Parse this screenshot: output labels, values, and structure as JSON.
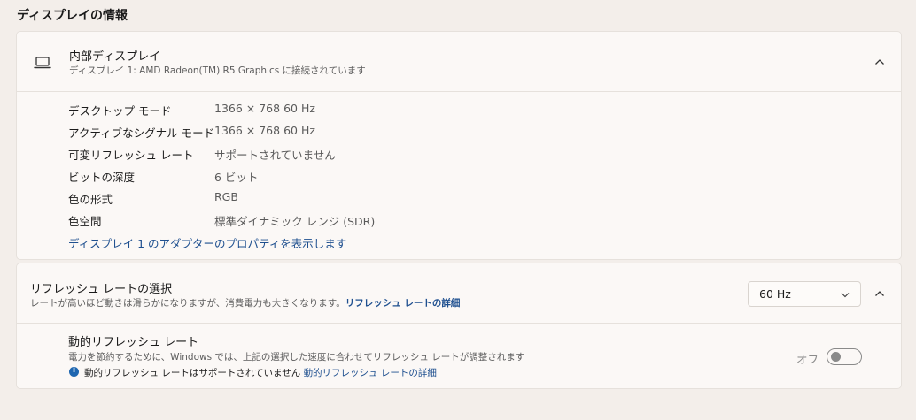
{
  "section_title": "ディスプレイの情報",
  "internal_display": {
    "title": "内部ディスプレイ",
    "subtitle": "ディスプレイ 1: AMD Radeon(TM) R5 Graphics に接続されています",
    "rows": [
      {
        "label": "デスクトップ モード",
        "value": "1366 × 768 60 Hz"
      },
      {
        "label": "アクティブなシグナル モード",
        "value": "1366 × 768 60 Hz"
      },
      {
        "label": "可変リフレッシュ レート",
        "value": "サポートされていません"
      },
      {
        "label": "ビットの深度",
        "value": "6 ビット"
      },
      {
        "label": "色の形式",
        "value": "RGB"
      },
      {
        "label": "色空間",
        "value": "標準ダイナミック レンジ (SDR)"
      }
    ],
    "adapter_link": "ディスプレイ 1 のアダプターのプロパティを表示します",
    "icon": "laptop-icon"
  },
  "refresh_rate": {
    "title": "リフレッシュ レートの選択",
    "description": "レートが高いほど動きは滑らかになりますが、消費電力も大きくなります。",
    "details_link": "リフレッシュ レートの詳細",
    "selected": "60 Hz",
    "dynamic": {
      "title": "動的リフレッシュ レート",
      "description": "電力を節約するために、Windows では、上記の選択した速度に合わせてリフレッシュ レートが調整されます",
      "note": "動的リフレッシュ レートはサポートされていません",
      "note_link": "動的リフレッシュ レートの詳細",
      "toggle_label": "オフ",
      "enabled": false
    }
  },
  "colors": {
    "accent_link": "#1e4f8f",
    "info_icon": "#1e66b0"
  }
}
